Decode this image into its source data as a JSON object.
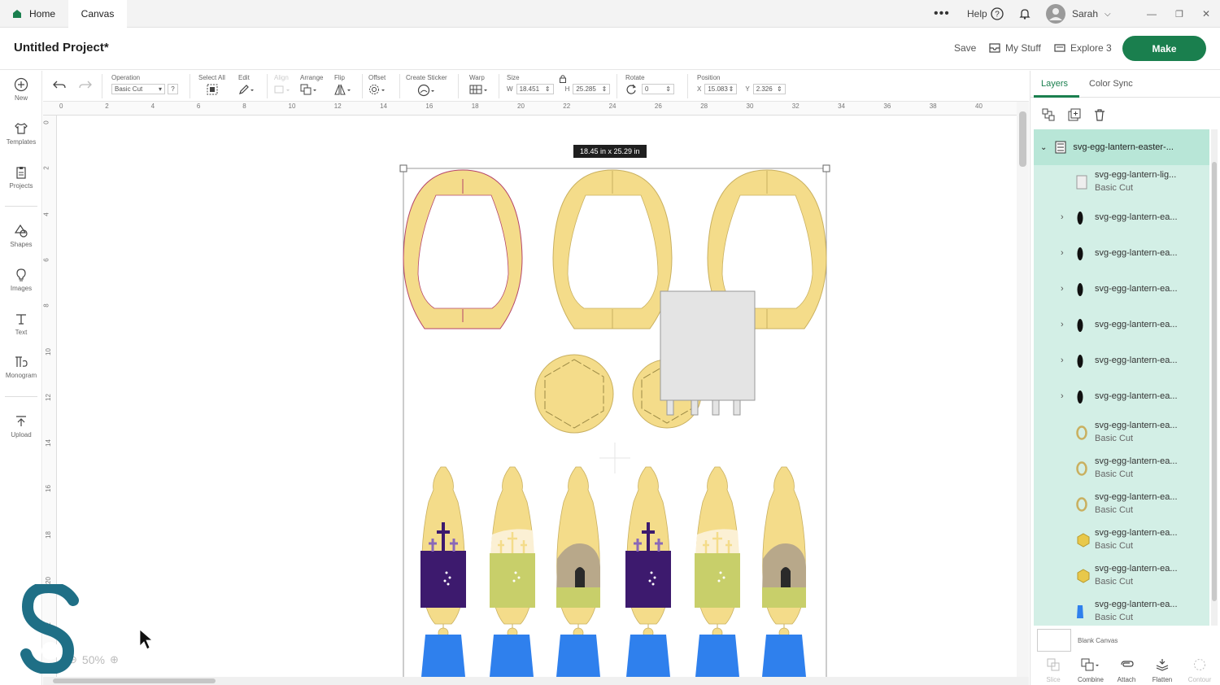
{
  "titlebar": {
    "tabs": [
      {
        "label": "Home"
      },
      {
        "label": "Canvas"
      }
    ],
    "help_label": "Help",
    "user_name": "Sarah"
  },
  "project": {
    "title": "Untitled Project*",
    "save_label": "Save",
    "mystuff_label": "My Stuff",
    "explore_label": "Explore 3",
    "make_label": "Make"
  },
  "leftbar": {
    "items": [
      {
        "label": "New",
        "icon": "plus-circle-icon"
      },
      {
        "label": "Templates",
        "icon": "shirt-icon"
      },
      {
        "label": "Projects",
        "icon": "clipboard-icon"
      },
      {
        "label": "Shapes",
        "icon": "shapes-icon"
      },
      {
        "label": "Images",
        "icon": "lightbulb-icon"
      },
      {
        "label": "Text",
        "icon": "text-icon"
      },
      {
        "label": "Monogram",
        "icon": "monogram-icon"
      },
      {
        "label": "Upload",
        "icon": "upload-icon"
      }
    ]
  },
  "toolbar": {
    "operation_label": "Operation",
    "operation_value": "Basic Cut",
    "help_q": "?",
    "select_all_label": "Select All",
    "edit_label": "Edit",
    "align_label": "Align",
    "arrange_label": "Arrange",
    "flip_label": "Flip",
    "offset_label": "Offset",
    "create_sticker_label": "Create Sticker",
    "warp_label": "Warp",
    "size_label": "Size",
    "w_label": "W",
    "w_value": "18.451",
    "h_label": "H",
    "h_value": "25.285",
    "rotate_label": "Rotate",
    "rotate_value": "0",
    "position_label": "Position",
    "x_label": "X",
    "x_value": "15.083",
    "y_label": "Y",
    "y_value": "2.326"
  },
  "ruler": {
    "top": [
      "0",
      "2",
      "4",
      "6",
      "8",
      "10",
      "12",
      "14",
      "16",
      "18",
      "20",
      "22",
      "24",
      "26",
      "28",
      "30",
      "32",
      "34",
      "36",
      "38",
      "40"
    ],
    "left": [
      "0",
      "2",
      "4",
      "6",
      "8",
      "10",
      "12",
      "14",
      "16",
      "18",
      "20",
      "22"
    ]
  },
  "canvas": {
    "size_tooltip": "18.45  in x 25.29  in",
    "zoom": "50%",
    "colors": {
      "egg": "#f4dc8a",
      "egg_stroke": "#c9b060",
      "purple": "#3d1a6e",
      "green": "#c8cf6a",
      "blue": "#2f80ed",
      "gray": "#e4e4e4"
    }
  },
  "rightpanel": {
    "tabs": [
      {
        "label": "Layers"
      },
      {
        "label": "Color Sync"
      }
    ],
    "group_name": "svg-egg-lantern-easter-...",
    "layers": [
      {
        "name": "svg-egg-lantern-lig...",
        "sub": "Basic Cut",
        "chevron": "",
        "thumb": "square"
      },
      {
        "name": "svg-egg-lantern-ea...",
        "sub": "",
        "chevron": "›",
        "thumb": "egg-dark"
      },
      {
        "name": "svg-egg-lantern-ea...",
        "sub": "",
        "chevron": "›",
        "thumb": "egg-dark"
      },
      {
        "name": "svg-egg-lantern-ea...",
        "sub": "",
        "chevron": "›",
        "thumb": "egg-dark"
      },
      {
        "name": "svg-egg-lantern-ea...",
        "sub": "",
        "chevron": "›",
        "thumb": "egg-dark"
      },
      {
        "name": "svg-egg-lantern-ea...",
        "sub": "",
        "chevron": "›",
        "thumb": "egg-dark"
      },
      {
        "name": "svg-egg-lantern-ea...",
        "sub": "",
        "chevron": "›",
        "thumb": "egg-dark"
      },
      {
        "name": "svg-egg-lantern-ea...",
        "sub": "Basic Cut",
        "chevron": "",
        "thumb": "egg-ring"
      },
      {
        "name": "svg-egg-lantern-ea...",
        "sub": "Basic Cut",
        "chevron": "",
        "thumb": "egg-ring"
      },
      {
        "name": "svg-egg-lantern-ea...",
        "sub": "Basic Cut",
        "chevron": "",
        "thumb": "egg-ring"
      },
      {
        "name": "svg-egg-lantern-ea...",
        "sub": "Basic Cut",
        "chevron": "",
        "thumb": "hexagon"
      },
      {
        "name": "svg-egg-lantern-ea...",
        "sub": "Basic Cut",
        "chevron": "",
        "thumb": "hexagon"
      },
      {
        "name": "svg-egg-lantern-ea...",
        "sub": "Basic Cut",
        "chevron": "",
        "thumb": "blue"
      }
    ],
    "blank_canvas_label": "Blank Canvas",
    "bottom_tools": [
      {
        "label": "Slice",
        "enabled": false
      },
      {
        "label": "Combine",
        "enabled": true
      },
      {
        "label": "Attach",
        "enabled": true
      },
      {
        "label": "Flatten",
        "enabled": true
      },
      {
        "label": "Contour",
        "enabled": false
      }
    ]
  }
}
